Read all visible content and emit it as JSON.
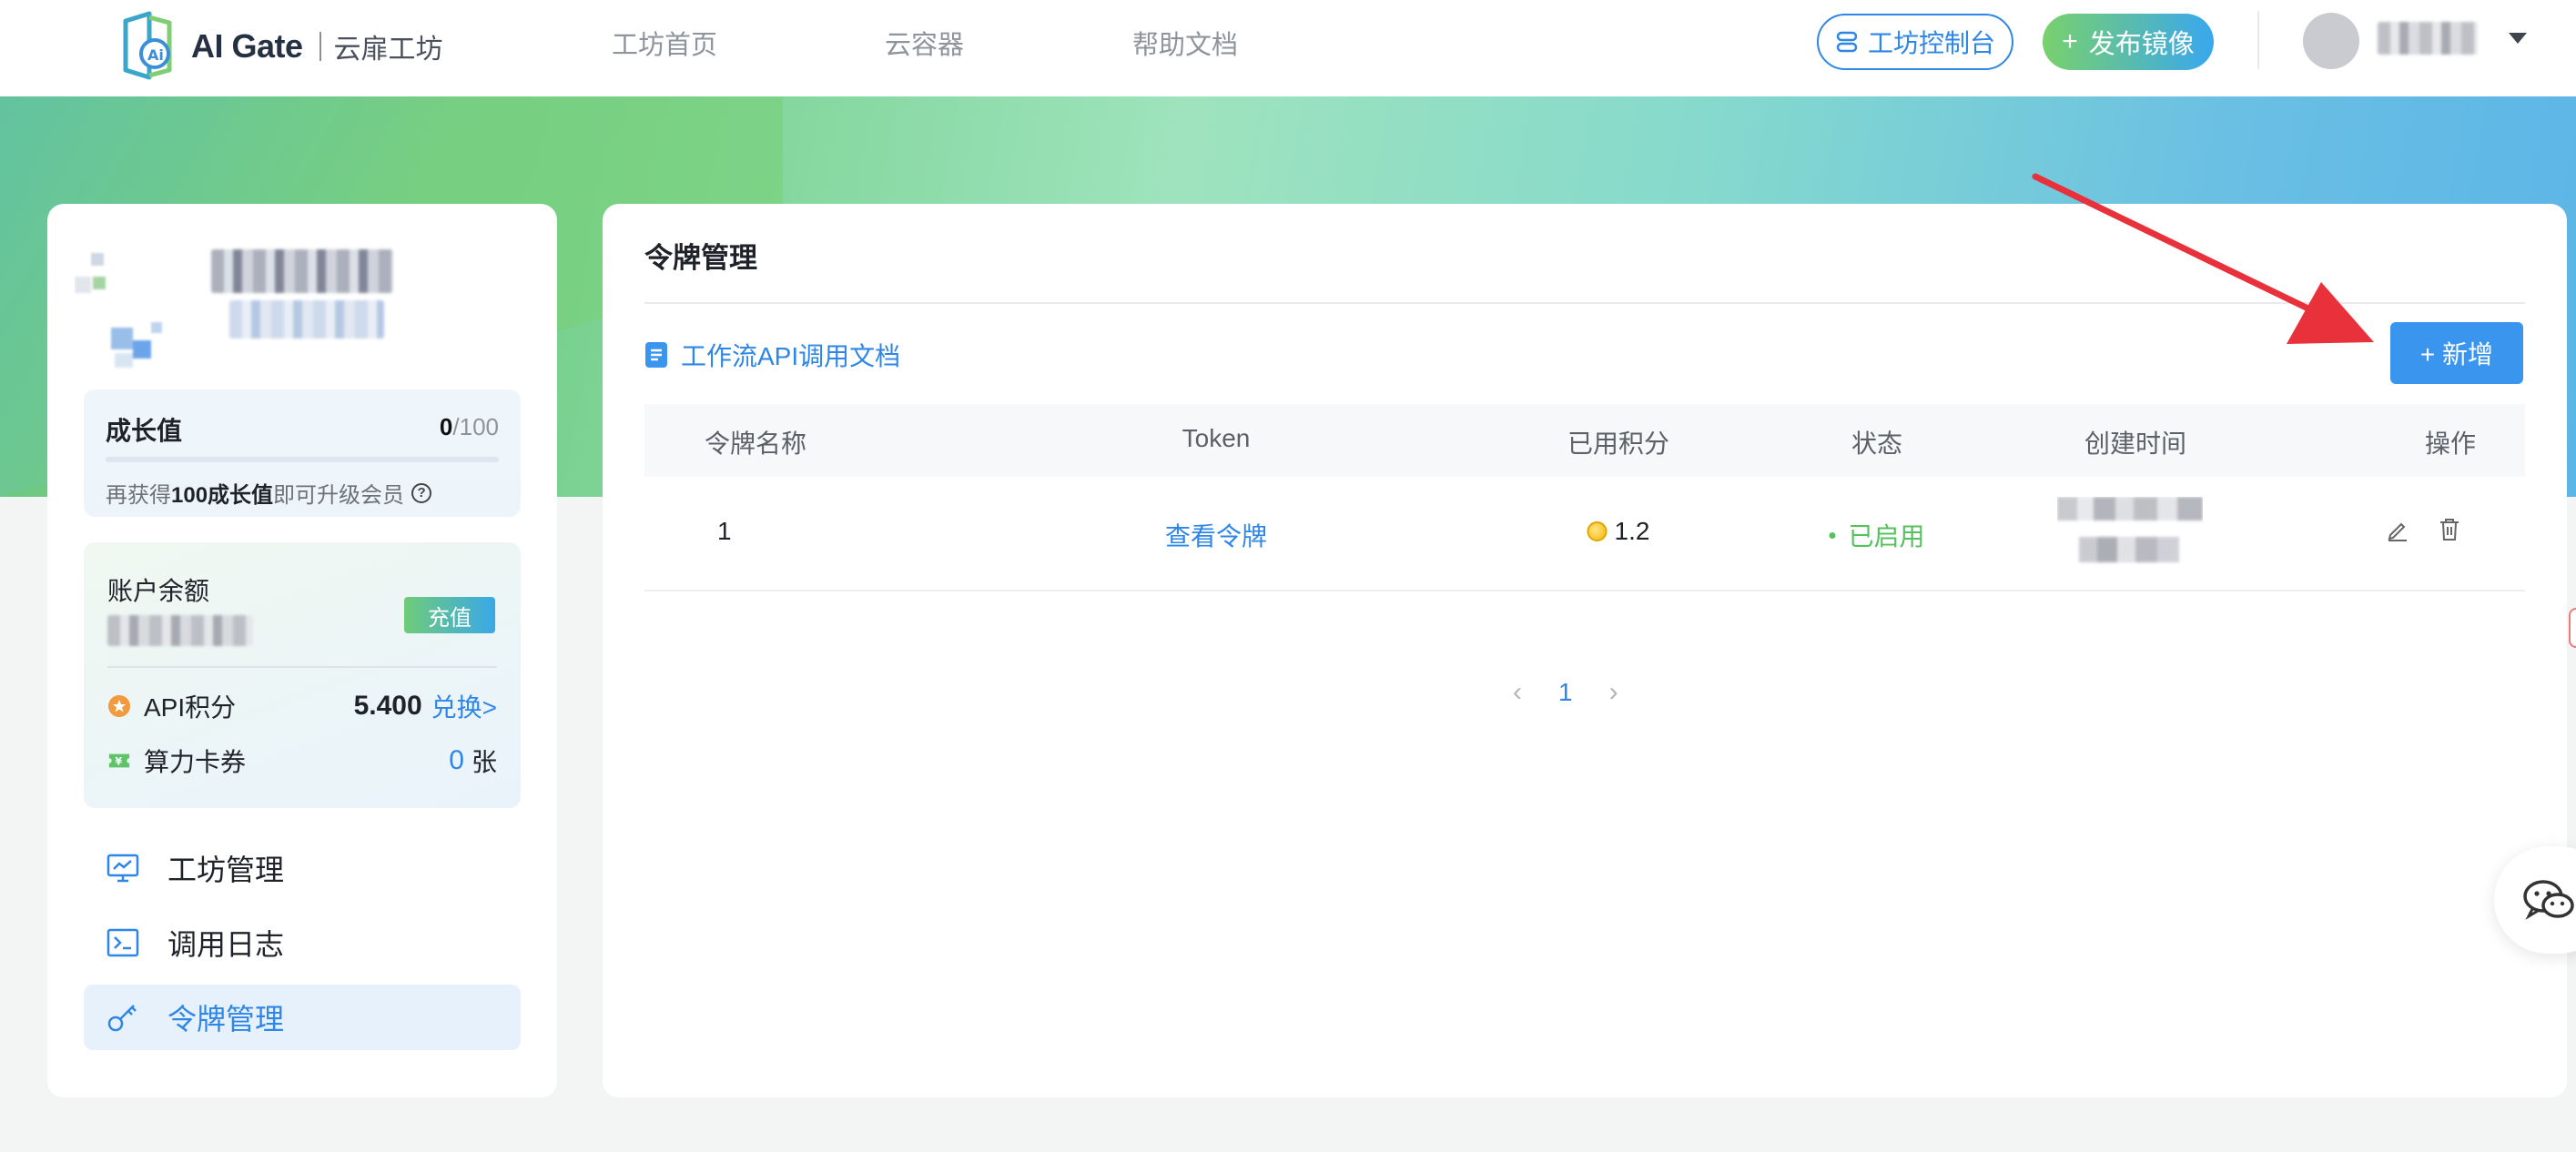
{
  "header": {
    "brand": "AI Gate",
    "brand_sub": "云扉工坊",
    "nav": [
      "工坊首页",
      "云容器",
      "帮助文档"
    ],
    "console_label": "工坊控制台",
    "publish_label": "发布镜像"
  },
  "sidebar": {
    "growth": {
      "title": "成长值",
      "current": "0",
      "max": "/100",
      "progress": 0,
      "tip_prefix": "再获得",
      "tip_bold": "100成长值",
      "tip_suffix": "即可升级会员"
    },
    "balance": {
      "label": "账户余额",
      "recharge_label": "充值"
    },
    "api_points": {
      "label": "API积分",
      "value": "5.400",
      "action": "兑换>"
    },
    "vouchers": {
      "label": "算力卡券",
      "count": "0",
      "unit": "张"
    },
    "menu": [
      {
        "label": "工坊管理",
        "icon": "monitor-icon",
        "active": false
      },
      {
        "label": "调用日志",
        "icon": "terminal-icon",
        "active": false
      },
      {
        "label": "令牌管理",
        "icon": "key-icon",
        "active": true
      }
    ]
  },
  "panel": {
    "title": "令牌管理",
    "doc_link": "工作流API调用文档",
    "add_button": "+ 新增",
    "columns": [
      "令牌名称",
      "Token",
      "已用积分",
      "状态",
      "创建时间",
      "操作"
    ],
    "rows": [
      {
        "name": "1",
        "token_link": "查看令牌",
        "points": "1.2",
        "status": "已启用"
      }
    ],
    "pagination": {
      "current": "1"
    }
  },
  "colors": {
    "primary": "#2e86e6",
    "success": "#55c15f",
    "annotation": "#e8313a"
  }
}
